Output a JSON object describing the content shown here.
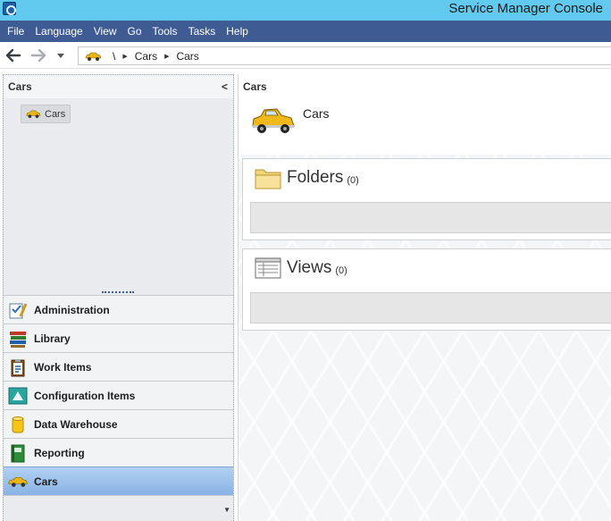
{
  "window": {
    "title": "Service Manager Console"
  },
  "menu": [
    "File",
    "Language",
    "View",
    "Go",
    "Tools",
    "Tasks",
    "Help"
  ],
  "nav": {
    "back_icon": "back-arrow-icon",
    "forward_icon": "forward-arrow-icon",
    "breadcrumb": [
      "\\",
      "Cars",
      "Cars"
    ]
  },
  "left_pane": {
    "title": "Cars",
    "tree_item": "Cars",
    "workspaces": [
      {
        "label": "Administration",
        "icon": "administration-icon",
        "active": false
      },
      {
        "label": "Library",
        "icon": "library-icon",
        "active": false
      },
      {
        "label": "Work Items",
        "icon": "work-items-icon",
        "active": false
      },
      {
        "label": "Configuration Items",
        "icon": "configuration-items-icon",
        "active": false
      },
      {
        "label": "Data Warehouse",
        "icon": "data-warehouse-icon",
        "active": false
      },
      {
        "label": "Reporting",
        "icon": "reporting-icon",
        "active": false
      },
      {
        "label": "Cars",
        "icon": "car-icon",
        "active": true
      }
    ]
  },
  "right_pane": {
    "title": "Cars",
    "subtitle": "Cars",
    "folders": {
      "label": "Folders",
      "count": "(0)"
    },
    "views": {
      "label": "Views",
      "count": "(0)"
    }
  },
  "colors": {
    "titlebar": "#62c9ef",
    "menubar": "#3e5c93",
    "active_workspace": "#9cc2ec"
  }
}
